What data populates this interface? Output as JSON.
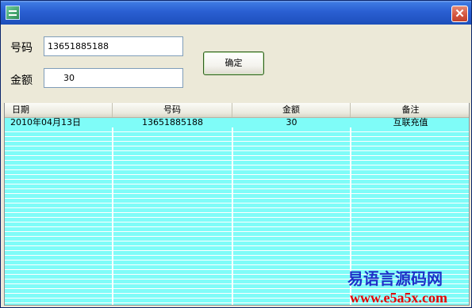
{
  "window": {
    "close_glyph": "✕",
    "icon": "app-icon"
  },
  "form": {
    "number_label": "号码",
    "number_value": "13651885188",
    "amount_label": "金额",
    "amount_value": "30",
    "confirm_label": "确定"
  },
  "grid": {
    "columns": [
      "日期",
      "号码",
      "金额",
      "备注"
    ],
    "rows": [
      {
        "date": "2010年04月13日",
        "number": "13651885188",
        "amount": "30",
        "note": "互联充值"
      }
    ],
    "row_color": "#7ffcf8"
  },
  "watermark": {
    "name": "易语言源码网",
    "url": "www.e5a5x.com"
  }
}
